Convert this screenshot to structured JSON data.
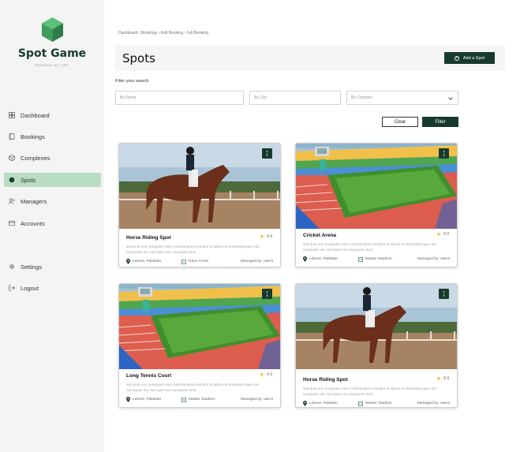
{
  "brand": {
    "name": "Spot Game",
    "tagline": "PASSION OF LIFE",
    "accent": "#173a2e",
    "logo_green": "#3f9e5e"
  },
  "sidebar": {
    "items": [
      {
        "label": "Dashboard",
        "icon": "grid-icon",
        "active": false
      },
      {
        "label": "Bookings",
        "icon": "book-icon",
        "active": false
      },
      {
        "label": "Complexes",
        "icon": "cube-icon",
        "active": false
      },
      {
        "label": "Spots",
        "icon": "circle-icon",
        "active": true
      },
      {
        "label": "Managers",
        "icon": "users-icon",
        "active": false
      },
      {
        "label": "Accounts",
        "icon": "card-icon",
        "active": false
      }
    ],
    "bottom": [
      {
        "label": "Settings",
        "icon": "gear-icon"
      },
      {
        "label": "Logout",
        "icon": "logout-icon"
      }
    ]
  },
  "breadcrumb": "Dashboard  ›  Bookings  ›  Add Booking  ›  Full Booking",
  "header": {
    "title": "Spots",
    "add_label": "Add a Spot"
  },
  "filters": {
    "label": "Filter your search",
    "by_name_placeholder": "By Name",
    "by_city_placeholder": "By City",
    "by_complex_placeholder": "By Complex",
    "clear_label": "Clear",
    "filter_label": "Filter"
  },
  "cards": [
    {
      "title": "Horse Riding Spot",
      "rating": "4.9",
      "image": "horse",
      "desc": "sed quia non numquam eius modi tempora incidunt ut labore et doloresed quia non numquam eiu, sed quia non numquam eius",
      "location": "Lahore, Pakistan",
      "venue": "Race Corse",
      "manager": "Managed by: user3"
    },
    {
      "title": "Cricket Arena",
      "rating": "4.9",
      "image": "stadium",
      "desc": "sed quia non numquam eius modi tempora incidunt ut labore et doloresed quia non numquam eiu, sed quia non numquam eius",
      "location": "Lahore, Pakistan",
      "venue": "Master Stadium",
      "manager": "Managed by: user3"
    },
    {
      "title": "Long Tennis Court",
      "rating": "4.9",
      "image": "stadium",
      "desc": "sed quia non numquam eius modi tempora incidunt ut labore et doloresed quia non numquam eiu, sed quia non numquam eius",
      "location": "Lahore, Pakistan",
      "venue": "Master Stadium",
      "manager": "Managed by: user3"
    },
    {
      "title": "Horse Riding Spot",
      "rating": "4.9",
      "image": "horse",
      "desc": "sed quia non numquam eius modi tempora incidunt ut labore et doloresed quia non numquam eiu, sed quia non numquam eius",
      "location": "Lahore, Pakistan",
      "venue": "Master Stadium",
      "manager": "Managed by: user3"
    }
  ]
}
